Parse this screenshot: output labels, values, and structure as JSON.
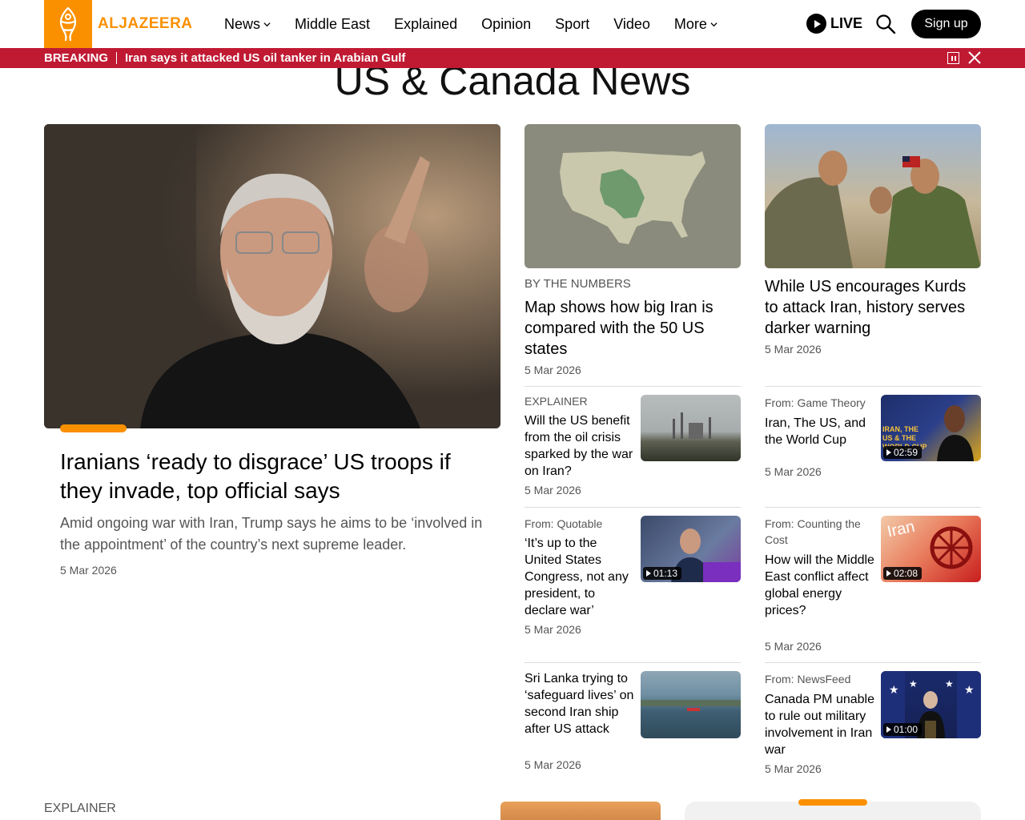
{
  "header": {
    "logo_text": "ALJAZEERA",
    "nav": [
      "News",
      "Middle East",
      "Explained",
      "Opinion",
      "Sport",
      "Video",
      "More"
    ],
    "live_label": "LIVE",
    "signup_label": "Sign up"
  },
  "breaking": {
    "label": "BREAKING",
    "text": "Iran says it attacked US oil tanker in Arabian Gulf"
  },
  "page_title": "US & Canada News",
  "hero": {
    "title": "Iranians ‘ready to disgrace’ US troops if they invade, top official says",
    "subtitle": "Amid ongoing war with Iran, Trump says he aims to be ‘involved in the appointment’ of the country’s next supreme leader.",
    "date": "5 Mar 2026"
  },
  "col2": {
    "top": {
      "kicker": "BY THE NUMBERS",
      "title": "Map shows how big Iran is compared with the 50 US states",
      "date": "5 Mar 2026"
    },
    "items": [
      {
        "kicker": "EXPLAINER",
        "title": "Will the US benefit from the oil crisis sparked by the war on Iran?",
        "date": "5 Mar 2026"
      },
      {
        "from": "From: Quotable",
        "title": "‘It’s up to the United States Congress, not any president, to declare war’",
        "date": "5 Mar 2026",
        "duration": "01:13"
      },
      {
        "title": "Sri Lanka trying to ‘safeguard lives’ on second Iran ship after US attack",
        "date": "5 Mar 2026"
      }
    ]
  },
  "col3": {
    "top": {
      "title": "While US encourages Kurds to attack Iran, history serves darker warning",
      "date": "5 Mar 2026"
    },
    "items": [
      {
        "from": "From: Game Theory",
        "title": "Iran, The US, and the World Cup",
        "date": "5 Mar 2026",
        "duration": "02:59",
        "thumb_text": "IRAN, THE US & THE WORLD CUP"
      },
      {
        "from": "From: Counting the Cost",
        "title": "How will the Middle East conflict affect global energy prices?",
        "date": "5 Mar 2026",
        "duration": "02:08",
        "thumb_text": "Iran"
      },
      {
        "from": "From: NewsFeed",
        "title": "Canada PM unable to rule out military involvement in Iran war",
        "date": "5 Mar 2026",
        "duration": "01:00"
      }
    ]
  },
  "bottom": {
    "kicker": "EXPLAINER"
  },
  "colors": {
    "brand": "#fa9000",
    "breaking": "#c01a33"
  }
}
